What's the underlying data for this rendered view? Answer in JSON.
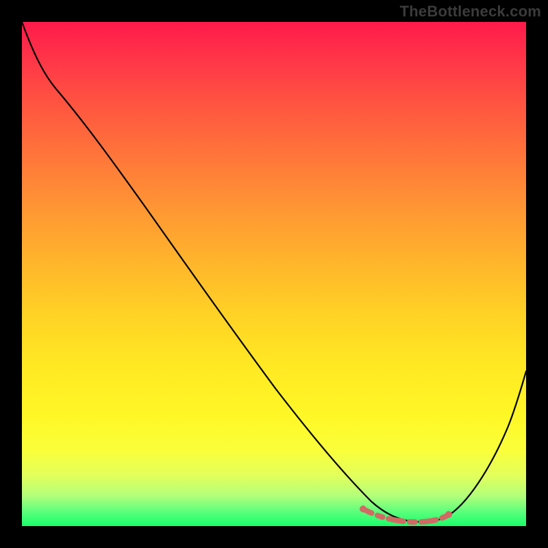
{
  "watermark": {
    "text": "TheBottleneck.com"
  },
  "chart_data": {
    "type": "line",
    "title": "",
    "xlabel": "",
    "ylabel": "",
    "xlim": [
      0,
      100
    ],
    "ylim": [
      0,
      100
    ],
    "series": [
      {
        "name": "bottleneck-curve",
        "x": [
          0,
          6,
          12,
          20,
          30,
          40,
          50,
          58,
          63,
          67,
          70,
          74,
          78,
          82,
          85,
          90,
          95,
          100
        ],
        "y": [
          100,
          92,
          87,
          78,
          66,
          53,
          40,
          28,
          19,
          11,
          5,
          2,
          1,
          1,
          2,
          10,
          24,
          40
        ]
      },
      {
        "name": "optimal-range-marker",
        "x": [
          67,
          70,
          72,
          74,
          76,
          78,
          80,
          82,
          84
        ],
        "y": [
          3.2,
          2.4,
          2.0,
          1.7,
          1.6,
          1.6,
          1.7,
          2.0,
          2.6
        ]
      }
    ],
    "gradient_stops": [
      {
        "pos": 0,
        "color": "#ff1a4b"
      },
      {
        "pos": 50,
        "color": "#ffd225"
      },
      {
        "pos": 100,
        "color": "#18ff6a"
      }
    ]
  }
}
